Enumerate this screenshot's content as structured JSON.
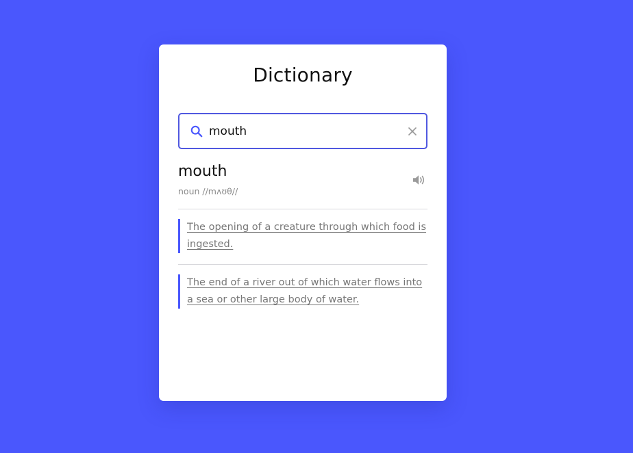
{
  "app": {
    "title": "Dictionary"
  },
  "search": {
    "value": "mouth"
  },
  "result": {
    "word": "mouth",
    "phonetic": "noun //mʌʊθ//",
    "meanings": [
      "The opening of a creature through which food is ingested.",
      "The end of a river out of which water flows into a sea or other large body of water."
    ]
  },
  "icons": {
    "search": "search-icon",
    "clear": "close-icon",
    "audio": "speaker-icon"
  },
  "colors": {
    "background": "#4a57fd",
    "accent": "#5058e0",
    "card": "#ffffff",
    "muted_text": "#777777"
  }
}
